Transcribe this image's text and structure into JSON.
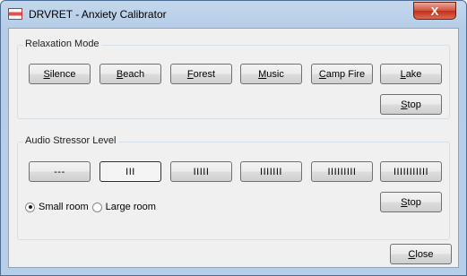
{
  "window": {
    "title": "DRVRET - Anxiety Calibrator",
    "close_glyph": "X"
  },
  "relaxation": {
    "label": "Relaxation Mode",
    "buttons": [
      {
        "pre": "",
        "ul": "S",
        "post": "ilence"
      },
      {
        "pre": "",
        "ul": "B",
        "post": "each"
      },
      {
        "pre": "",
        "ul": "F",
        "post": "orest"
      },
      {
        "pre": "",
        "ul": "M",
        "post": "usic"
      },
      {
        "pre": "",
        "ul": "C",
        "post": "amp Fire"
      },
      {
        "pre": "",
        "ul": "L",
        "post": "ake"
      }
    ],
    "stop": {
      "pre": "",
      "ul": "S",
      "post": "top"
    }
  },
  "stressor": {
    "label": "Audio Stressor Level",
    "levels": [
      "---",
      "III",
      "IIIII",
      "IIIIIII",
      "IIIIIIIII",
      "IIIIIIIIIII"
    ],
    "selected_level": 1,
    "room_options": [
      "Small room",
      "Large room"
    ],
    "selected_room": "Small room",
    "stop": {
      "pre": "",
      "ul": "S",
      "post": "top"
    }
  },
  "close": {
    "pre": "",
    "ul": "C",
    "post": "lose"
  }
}
